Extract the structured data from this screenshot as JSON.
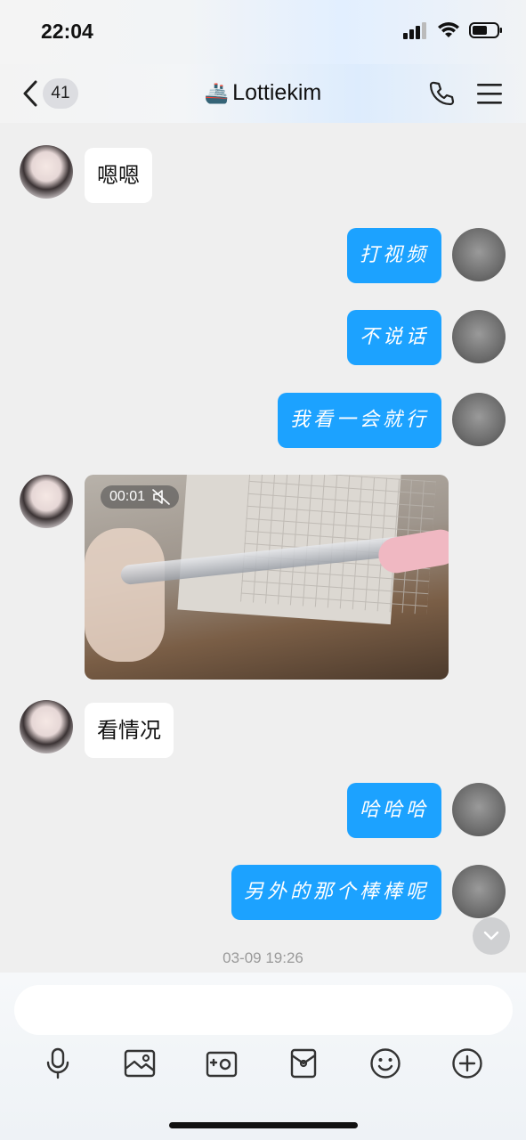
{
  "status": {
    "time": "22:04"
  },
  "nav": {
    "unread_count": "41",
    "contact_emoji": "🚢",
    "contact_name": "Lottiekim"
  },
  "messages": [
    {
      "side": "left",
      "text": "嗯嗯"
    },
    {
      "side": "right",
      "text": "打视频"
    },
    {
      "side": "right",
      "text": "不说话"
    },
    {
      "side": "right",
      "text": "我看一会就行"
    },
    {
      "side": "left",
      "type": "video",
      "duration": "00:01"
    },
    {
      "side": "left",
      "text": "看情况"
    },
    {
      "side": "right",
      "text": "哈哈哈"
    },
    {
      "side": "right",
      "text": "另外的那个棒棒呢"
    }
  ],
  "timestamp": "03-09 19:26",
  "composer": {
    "placeholder": ""
  },
  "toolbar": [
    "microphone-icon",
    "image-icon",
    "camera-icon",
    "red-packet-icon",
    "emoji-icon",
    "plus-icon"
  ]
}
